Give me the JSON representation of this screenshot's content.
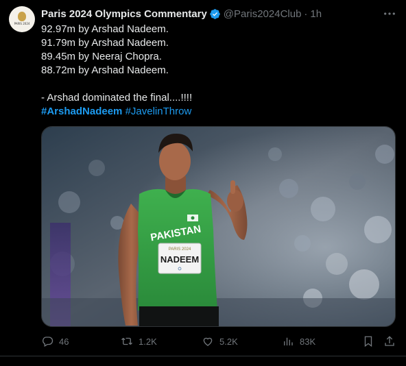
{
  "author": {
    "name": "Paris 2024 Olympics Commentary",
    "handle": "@Paris2024Club",
    "separator": "·",
    "time": "1h",
    "avatar_label": "PARIS 2024"
  },
  "tweet": {
    "lines": [
      "92.97m by Arshad Nadeem.",
      "91.79m by Arshad Nadeem.",
      "89.45m by Neeraj Chopra.",
      "88.72m by Arshad Nadeem."
    ],
    "closing": "- Arshad dominated the final....!!!!",
    "hashtags": [
      "#ArshadNadeem",
      "#JavelinThrow"
    ]
  },
  "image": {
    "jersey_country": "PAKISTAN",
    "bib_event": "PARIS 2024",
    "bib_name": "NADEEM"
  },
  "stats": {
    "replies": "46",
    "reposts": "1.2K",
    "likes": "5.2K",
    "views": "83K"
  },
  "colors": {
    "background": "#000000",
    "text": "#e7e9ea",
    "muted": "#71767b",
    "accent": "#1d9bf0",
    "jersey": "#3aa64a"
  },
  "icons": {
    "verified": "verified-badge-icon",
    "more": "more-icon",
    "reply": "reply-icon",
    "repost": "repost-icon",
    "like": "heart-icon",
    "views": "views-icon",
    "bookmark": "bookmark-icon",
    "share": "share-icon"
  }
}
